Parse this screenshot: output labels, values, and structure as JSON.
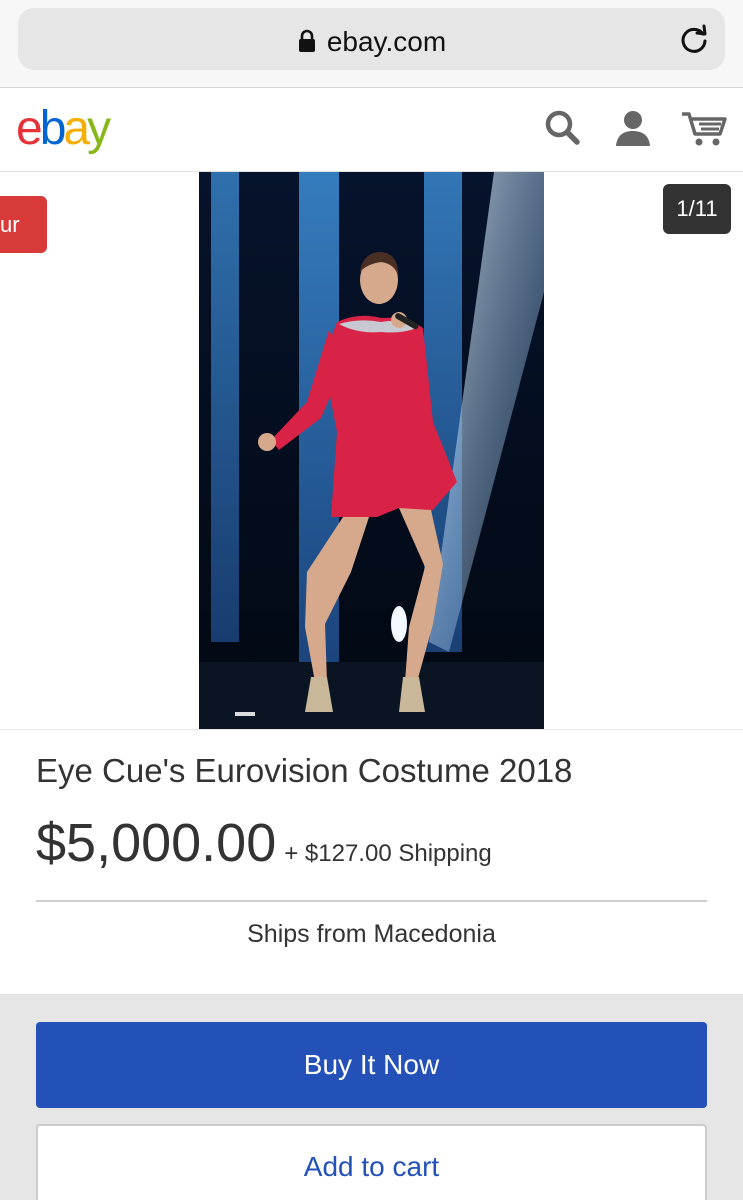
{
  "browser": {
    "url": "ebay.com",
    "lock_icon": "lock-icon",
    "reload_icon": "reload-icon"
  },
  "header": {
    "logo": {
      "e": "e",
      "b": "b",
      "a": "a",
      "y": "y"
    },
    "icons": [
      "search-icon",
      "user-icon",
      "cart-icon"
    ],
    "colors": {
      "e": "#e53238",
      "b": "#0064d2",
      "a": "#f5af02",
      "y": "#86b817"
    }
  },
  "gallery": {
    "left_badge": "ur",
    "counter": "1/11"
  },
  "item": {
    "title": "Eye Cue's Eurovision Costume 2018",
    "price": "$5,000.00",
    "shipping": "+ $127.00 Shipping",
    "ships_from": "Ships from Macedonia"
  },
  "actions": {
    "buy_now": "Buy It Now",
    "add_to_cart": "Add to cart"
  },
  "colors": {
    "primary_button": "#2351b7",
    "badge": "#d83a3a"
  }
}
